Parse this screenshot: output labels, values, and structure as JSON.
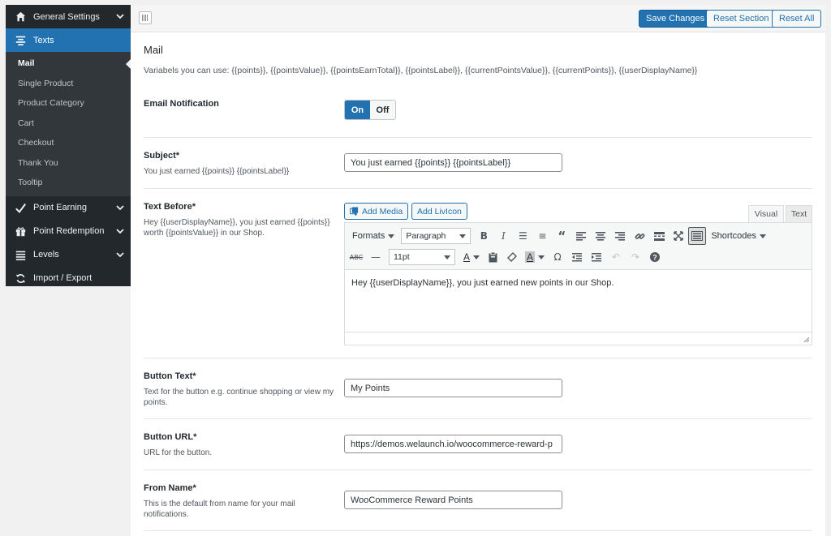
{
  "sidebar": {
    "items": [
      {
        "label": "General Settings",
        "icon": "home-icon"
      },
      {
        "label": "Texts",
        "icon": "align-center-icon"
      },
      {
        "label": "Point Earning",
        "icon": "checkmark-icon"
      },
      {
        "label": "Point Redemption",
        "icon": "gift-icon"
      },
      {
        "label": "Levels",
        "icon": "list-icon"
      },
      {
        "label": "Import / Export",
        "icon": "refresh-icon"
      }
    ],
    "sub_items": [
      "Mail",
      "Single Product",
      "Product Category",
      "Cart",
      "Checkout",
      "Thank You",
      "Tooltip"
    ]
  },
  "topbar": {
    "save": "Save Changes",
    "reset_section": "Reset Section",
    "reset_all": "Reset All"
  },
  "main": {
    "title": "Mail",
    "variables": "Variabels you can use: {{points}}, {{pointsValue}}, {{pointsEarnTotal}}, {{pointsLabel}}, {{currentPointsValue}}, {{currentPoints}}, {{userDisplayName}}",
    "email_notification": {
      "label": "Email Notification",
      "on": "On",
      "off": "Off",
      "value": "On"
    },
    "subject": {
      "label": "Subject*",
      "desc": "You just earned {{points}} {{pointsLabel}}",
      "value": "You just earned {{points}} {{pointsLabel}}"
    },
    "text_before": {
      "label": "Text Before*",
      "desc": "Hey {{userDisplayName}}, you just earned {{points}} worth {{pointsValue}} in our Shop.",
      "add_media": "Add Media",
      "add_livicon": "Add LivIcon",
      "tab_visual": "Visual",
      "tab_text": "Text",
      "formats": "Formats",
      "paragraph": "Paragraph",
      "shortcodes": "Shortcodes",
      "font_size": "11pt",
      "content": "Hey {{userDisplayName}}, you just earned new points in our Shop."
    },
    "button_text": {
      "label": "Button Text*",
      "desc": "Text for the button e.g. continue shopping or view my points.",
      "value": "My Points"
    },
    "button_url": {
      "label": "Button URL*",
      "desc": "URL for the button.",
      "value": "https://demos.welaunch.io/woocommerce-reward-p"
    },
    "from_name": {
      "label": "From Name*",
      "desc": "This is the default from name for your mail notifications.",
      "value": "WooCommerce Reward Points"
    }
  },
  "colors": {
    "accent": "#2271b1",
    "sidebar_bg": "#23282d",
    "submenu_bg": "#32373c"
  }
}
